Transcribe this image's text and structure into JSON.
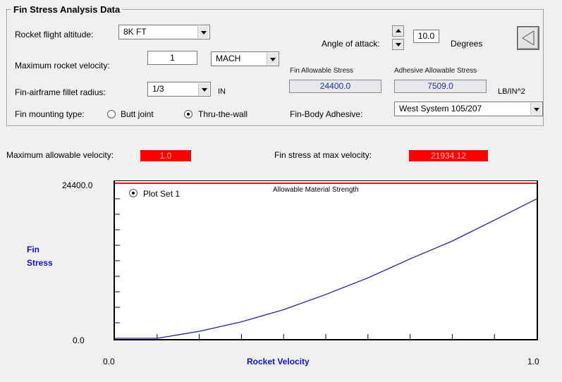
{
  "group_title": "Fin Stress Analysis Data",
  "altitude": {
    "label": "Rocket flight altitude:",
    "value": "8K FT"
  },
  "velocity": {
    "label": "Maximum rocket velocity:",
    "value": "1",
    "unit": "MACH"
  },
  "fillet": {
    "label": "Fin-airframe fillet radius:",
    "value": "1/3",
    "unit": "IN"
  },
  "mounting": {
    "label": "Fin mounting type:",
    "options": [
      "Butt joint",
      "Thru-the-wall"
    ],
    "selected": "Thru-the-wall"
  },
  "angle_of_attack": {
    "label": "Angle of attack:",
    "value": "10.0",
    "unit": "Degrees"
  },
  "fin_allowable": {
    "label": "Fin Allowable Stress",
    "value": "24400.0"
  },
  "adhesive_allowable": {
    "label": "Adhesive Allowable Stress",
    "value": "7509.0",
    "unit": "LB/IN^2"
  },
  "adhesive": {
    "label": "Fin-Body Adhesive:",
    "value": "West System 105/207"
  },
  "results": {
    "max_velocity_label": "Maximum allowable velocity:",
    "max_velocity_value": "1.0",
    "fin_stress_label": "Fin stress at max velocity:",
    "fin_stress_value": "21934.12"
  },
  "chart_data": {
    "type": "line",
    "title": "",
    "xlabel": "Rocket Velocity",
    "ylabel": "Fin Stress",
    "x_ticks": [
      "0.0",
      "1.0"
    ],
    "y_ticks": [
      "0.0",
      "24400.0"
    ],
    "xlim": [
      0.0,
      1.0
    ],
    "ylim": [
      0.0,
      24400.0
    ],
    "legend": "Plot Set 1",
    "legend_selected": true,
    "limit_line": {
      "label": "Allowable Material Strength",
      "value": 24400.0,
      "color": "#e02020"
    },
    "series": [
      {
        "name": "Plot Set 1",
        "color": "#2020a0",
        "x": [
          0.0,
          0.1,
          0.2,
          0.3,
          0.4,
          0.5,
          0.6,
          0.7,
          0.8,
          0.9,
          1.0
        ],
        "y": [
          0,
          0,
          1100,
          2600,
          4500,
          6900,
          9500,
          12500,
          15300,
          18600,
          21934.12
        ]
      }
    ]
  }
}
